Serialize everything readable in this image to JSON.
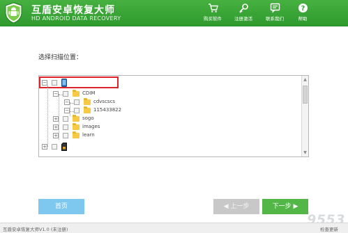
{
  "header": {
    "title": "互盾安卓恢复大师",
    "subtitle": "HD ANDROID DATA RECOVERY",
    "actions": [
      {
        "label": "购买软件",
        "icon": "cart-icon"
      },
      {
        "label": "注册激活",
        "icon": "key-icon"
      },
      {
        "label": "联系我们",
        "icon": "contact-icon"
      },
      {
        "label": "帮助",
        "icon": "help-icon"
      }
    ],
    "colors": {
      "header": "#36a234",
      "accent_blue": "#7ec7ee",
      "accent_green": "#52b747",
      "highlight": "#e0232a"
    }
  },
  "main": {
    "prompt": "选择扫描位置：",
    "tree": {
      "root_expander": "−",
      "nodes": [
        {
          "label": "CDIM",
          "expander": "−"
        },
        {
          "label": "cdvscscs",
          "expander": "−"
        },
        {
          "label": "115433822",
          "expander": "−"
        },
        {
          "label": "sogo",
          "expander": "+"
        },
        {
          "label": "images",
          "expander": "+"
        },
        {
          "label": "learn",
          "expander": "+"
        }
      ],
      "sd_expander": "+"
    }
  },
  "buttons": {
    "home": "首页",
    "prev": "上一步",
    "next": "下一步"
  },
  "status": {
    "version": "互盾安卓恢复大师V1.0 (未注册)",
    "update": "检查更新"
  },
  "watermark": "9553"
}
